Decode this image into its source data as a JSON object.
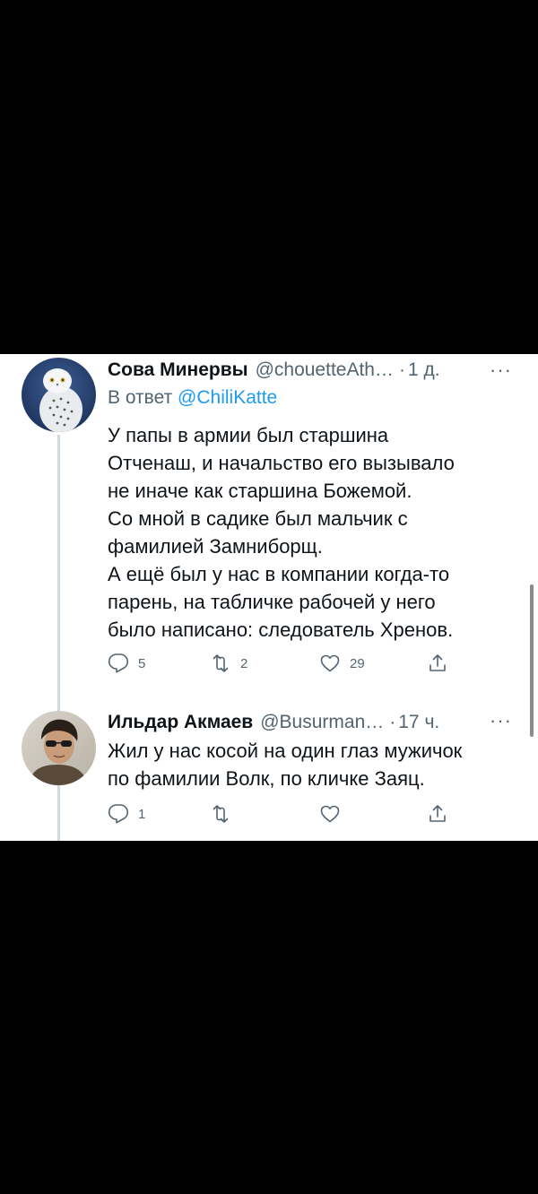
{
  "tweets": [
    {
      "author_name": "Сова Минервы",
      "handle": "@chouetteAth…",
      "separator": "·",
      "time": "1 д.",
      "reply_prefix": "В ответ",
      "reply_to": "@ChiliKatte",
      "text": "У папы в армии был старшина\nОтченаш, и начальство его вызывало\nне иначе как старшина Божемой.\nСо мной в садике был мальчик с\nфамилией Замниборщ.\nА ещё был у нас в компании когда-то\nпарень, на табличке рабочей у него\nбыло написано: следователь Хренов.",
      "replies": "5",
      "retweets": "2",
      "likes": "29",
      "avatar": "snowy-owl-avatar"
    },
    {
      "author_name": "Ильдар Акмаев",
      "handle": "@Busurman…",
      "separator": "·",
      "time": "17 ч.",
      "text": "Жил у нас косой на один глаз мужичок\nпо фамилии Волк, по кличке Заяц.",
      "replies": "1",
      "retweets": "",
      "likes": "",
      "avatar": "man-sunglasses-avatar"
    }
  ],
  "more_label": "···",
  "icons": {
    "reply": "reply-icon",
    "retweet": "retweet-icon",
    "like": "heart-icon",
    "share": "share-icon",
    "more": "more-icon"
  },
  "colors": {
    "link": "#1d9bf0",
    "secondary": "#536471",
    "text": "#0f1419",
    "thread_line": "#cfd9de"
  }
}
